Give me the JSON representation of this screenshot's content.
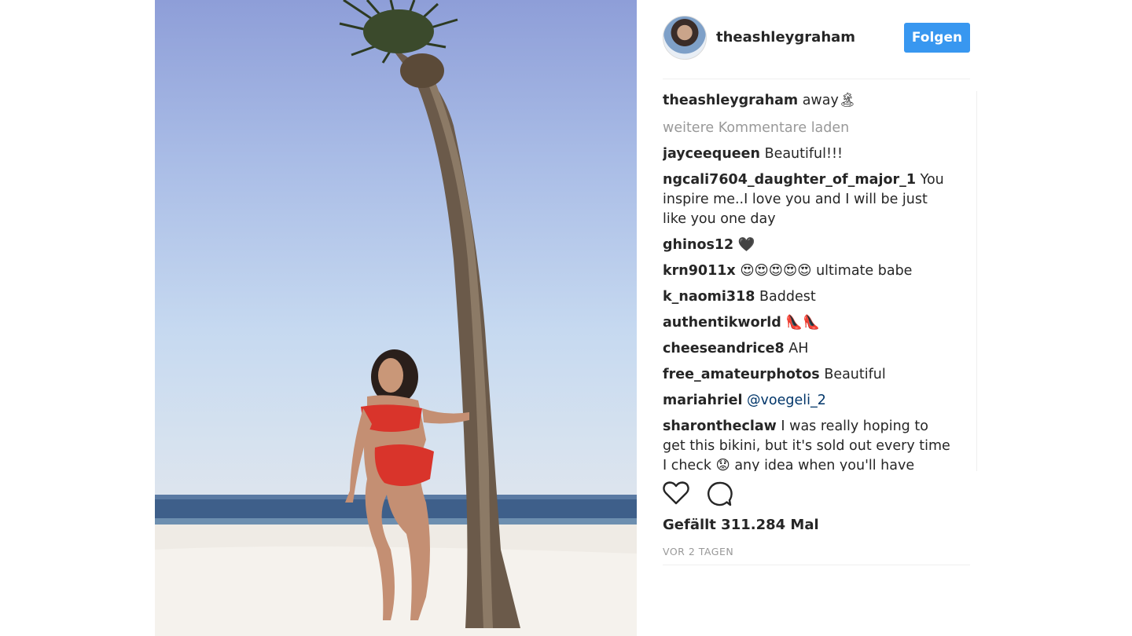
{
  "post": {
    "username": "theashleygraham",
    "follow_label": "Folgen",
    "caption_user": "theashleygraham",
    "caption_text": "away🏝",
    "load_more_label": "weitere Kommentare laden",
    "likes_text": "Gefällt 311.284 Mal",
    "date_text": "VOR 2 TAGEN",
    "icons": {
      "like": "heart-icon",
      "comment": "comment-icon"
    }
  },
  "comments": [
    {
      "user": "jayceequeen",
      "text": "Beautiful!!!"
    },
    {
      "user": "ngcali7604_daughter_of_major_1",
      "text": "You inspire me..I love you and I will be just like you one day"
    },
    {
      "user": "ghinos12",
      "text": "🖤"
    },
    {
      "user": "krn9011x",
      "text": "😍😍😍😍😍 ultimate babe"
    },
    {
      "user": "k_naomi318",
      "text": "Baddest"
    },
    {
      "user": "authentikworld",
      "text": "👠👠"
    },
    {
      "user": "cheeseandrice8",
      "text": "AH"
    },
    {
      "user": "free_amateurphotos",
      "text": "Beautiful"
    },
    {
      "user": "mariahriel",
      "mention": "@voegeli_2"
    },
    {
      "user": "sharontheclaw",
      "text": "I was really hoping to get this bikini, but it's sold out every time I check 😟 any idea when you'll have some"
    }
  ],
  "colors": {
    "follow_button": "#3897f0",
    "mention": "#003569",
    "muted": "#999999"
  }
}
